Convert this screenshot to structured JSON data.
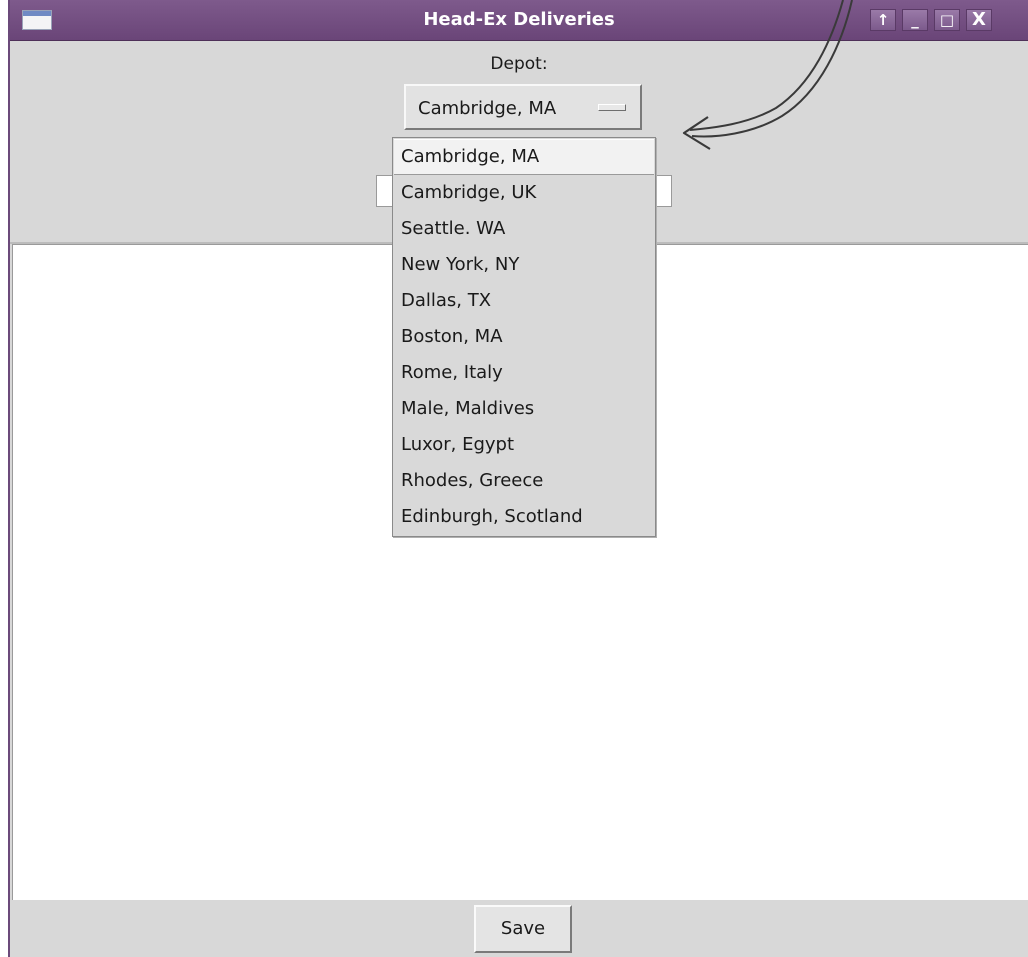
{
  "window": {
    "title": "Head-Ex Deliveries",
    "title_bar_color": "#74507f"
  },
  "titlebar_buttons": {
    "up": "↑",
    "minimize": "_",
    "maximize": "□",
    "close": "X"
  },
  "depot": {
    "label": "Depot:",
    "selected": "Cambridge, MA",
    "options": [
      "Cambridge, MA",
      "Cambridge, UK",
      "Seattle. WA",
      "New York, NY",
      "Dallas, TX",
      "Boston, MA",
      "Rome, Italy",
      "Male, Maldives",
      "Luxor, Egypt",
      "Rhodes, Greece",
      "Edinburgh, Scotland"
    ]
  },
  "footer": {
    "save_label": "Save"
  },
  "icons": {
    "app": "window-app-icon",
    "up": "arrow-up-icon",
    "minimize": "minimize-icon",
    "maximize": "maximize-icon",
    "close": "close-icon",
    "dropdown": "option-menu-indicator-icon",
    "annotation": "hand-drawn-arrow"
  }
}
